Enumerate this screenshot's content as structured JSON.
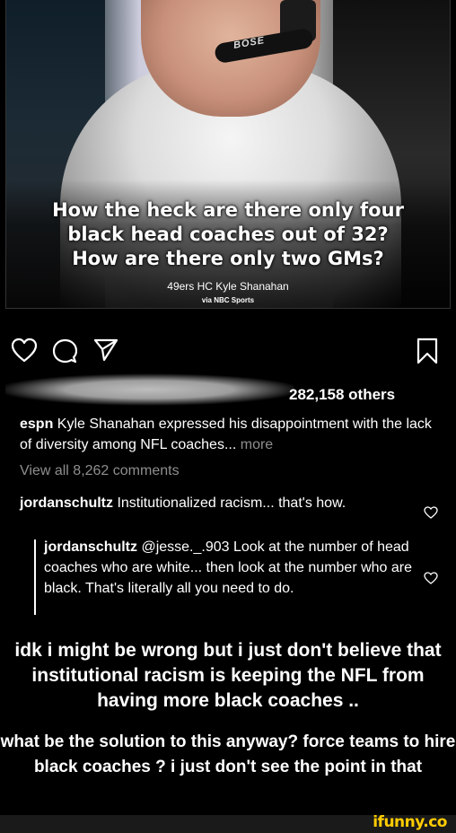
{
  "post_image": {
    "headline_lines": [
      "How the heck are there only four",
      "black head coaches out of 32?",
      "How are there only two GMs?"
    ],
    "credit": "49ers HC Kyle Shanahan",
    "credit_sub": "via NBC Sports",
    "mic_brand": "BOSE"
  },
  "actions": {
    "icons": [
      "heart-icon",
      "comment-icon",
      "share-icon",
      "save-icon"
    ]
  },
  "likes": {
    "text": "282,158 others"
  },
  "caption": {
    "username": "espn",
    "text": " Kyle Shanahan expressed his disappointment with the lack of diversity among NFL coaches...",
    "more": " more"
  },
  "comments": {
    "view_all": "View all 8,262 comments",
    "items": [
      {
        "username": "jordanschultz",
        "text": " Institutionalized racism... that's how."
      },
      {
        "username": "jordanschultz",
        "text": " @jesse._.903 Look at the number of head coaches who are white... then look at the number who are black. That's literally all you need to do."
      }
    ]
  },
  "meme_text": {
    "paragraph1": "idk i might be wrong but i just don't believe that institutional racism is keeping the NFL from having more black coaches ..",
    "paragraph2": "what be the solution to this anyway? force teams to hire black coaches ? i just don't see the point in that"
  },
  "watermark": "ifunny.co",
  "colors": {
    "background": "#000000",
    "muted_text": "#8e8e8e",
    "watermark": "#ffcc00"
  }
}
